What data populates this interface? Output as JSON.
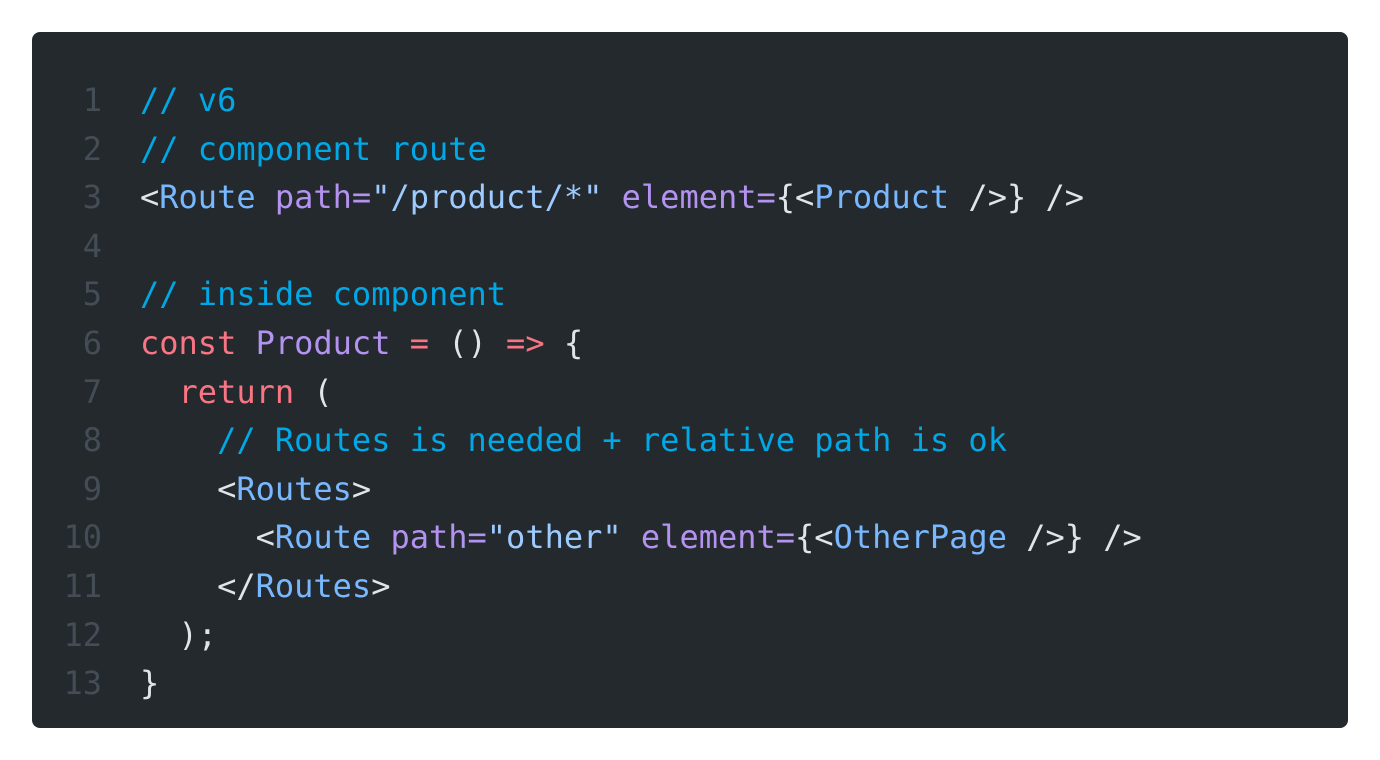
{
  "colors": {
    "background": "#24292e",
    "line_number": "#444d56",
    "default_text": "#e1e4e8",
    "comment": "#00a8e6",
    "tag": "#79b8ff",
    "attribute": "#b392f0",
    "string": "#9ecbff",
    "keyword": "#f97583",
    "function": "#b392f0"
  },
  "code": {
    "lines": [
      {
        "number": "1",
        "tokens": [
          {
            "type": "comment",
            "text": "// v6"
          }
        ]
      },
      {
        "number": "2",
        "tokens": [
          {
            "type": "comment",
            "text": "// component route"
          }
        ]
      },
      {
        "number": "3",
        "tokens": [
          {
            "type": "punct",
            "text": "<"
          },
          {
            "type": "tag",
            "text": "Route"
          },
          {
            "type": "punct",
            "text": " "
          },
          {
            "type": "attr",
            "text": "path="
          },
          {
            "type": "string",
            "text": "\"/product/*\""
          },
          {
            "type": "punct",
            "text": " "
          },
          {
            "type": "attr",
            "text": "element="
          },
          {
            "type": "punct",
            "text": "{<"
          },
          {
            "type": "tag",
            "text": "Product"
          },
          {
            "type": "punct",
            "text": " />} />"
          }
        ]
      },
      {
        "number": "4",
        "tokens": []
      },
      {
        "number": "5",
        "tokens": [
          {
            "type": "comment",
            "text": "// inside component"
          }
        ]
      },
      {
        "number": "6",
        "tokens": [
          {
            "type": "keyword",
            "text": "const "
          },
          {
            "type": "fn",
            "text": "Product"
          },
          {
            "type": "keyword",
            "text": " = "
          },
          {
            "type": "punct",
            "text": "() "
          },
          {
            "type": "keyword",
            "text": "=>"
          },
          {
            "type": "punct",
            "text": " {"
          }
        ]
      },
      {
        "number": "7",
        "tokens": [
          {
            "type": "punct",
            "text": "  "
          },
          {
            "type": "keyword",
            "text": "return"
          },
          {
            "type": "punct",
            "text": " ("
          }
        ]
      },
      {
        "number": "8",
        "tokens": [
          {
            "type": "punct",
            "text": "    "
          },
          {
            "type": "comment",
            "text": "// Routes is needed + relative path is ok"
          }
        ]
      },
      {
        "number": "9",
        "tokens": [
          {
            "type": "punct",
            "text": "    <"
          },
          {
            "type": "tag",
            "text": "Routes"
          },
          {
            "type": "punct",
            "text": ">"
          }
        ]
      },
      {
        "number": "10",
        "tokens": [
          {
            "type": "punct",
            "text": "      <"
          },
          {
            "type": "tag",
            "text": "Route"
          },
          {
            "type": "punct",
            "text": " "
          },
          {
            "type": "attr",
            "text": "path="
          },
          {
            "type": "string",
            "text": "\"other\""
          },
          {
            "type": "punct",
            "text": " "
          },
          {
            "type": "attr",
            "text": "element="
          },
          {
            "type": "punct",
            "text": "{<"
          },
          {
            "type": "tag",
            "text": "OtherPage"
          },
          {
            "type": "punct",
            "text": " />} />"
          }
        ]
      },
      {
        "number": "11",
        "tokens": [
          {
            "type": "punct",
            "text": "    </"
          },
          {
            "type": "tag",
            "text": "Routes"
          },
          {
            "type": "punct",
            "text": ">"
          }
        ]
      },
      {
        "number": "12",
        "tokens": [
          {
            "type": "punct",
            "text": "  );"
          }
        ]
      },
      {
        "number": "13",
        "tokens": [
          {
            "type": "punct",
            "text": "}"
          }
        ]
      }
    ]
  }
}
